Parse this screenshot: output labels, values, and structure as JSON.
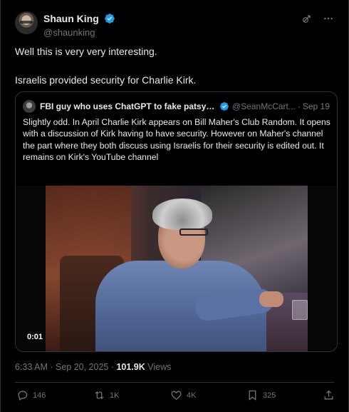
{
  "author": {
    "display_name": "Shaun King",
    "handle": "@shaunking"
  },
  "tweet": {
    "lines": [
      "Well this is very very interesting.",
      "Israelis provided security for Charlie Kirk."
    ]
  },
  "quote": {
    "display_name": "FBI guy who uses ChatGPT to fake patsy c...",
    "handle": "@SeanMcCart...",
    "separator": "·",
    "date": "Sep 19",
    "text": "Slightly odd. In April Charlie Kirk appears on Bill Maher's Club Random. It opens with a discussion of Kirk having to have security. However on Maher's channel the part where they both discuss using Israelis for their security is edited out. It remains on Kirk's YouTube channel",
    "video_timestamp": "0:01"
  },
  "meta": {
    "time": "6:33 AM",
    "separator": " · ",
    "date": "Sep 20, 2025",
    "separator2": " · ",
    "views": "101.9K",
    "views_label": " Views"
  },
  "actions": {
    "replies": "146",
    "reposts": "1K",
    "likes": "4K",
    "bookmarks": "325"
  },
  "colors": {
    "background": "#000000",
    "text": "#e7e9ea",
    "secondary": "#71767b",
    "border": "#2f3336",
    "verified": "#1d9bf0"
  },
  "icons": {
    "verified": "verified-badge-icon",
    "grok": "grok-icon",
    "more": "more-icon",
    "reply": "reply-icon",
    "repost": "repost-icon",
    "like": "heart-icon",
    "bookmark": "bookmark-icon",
    "share": "share-icon"
  }
}
